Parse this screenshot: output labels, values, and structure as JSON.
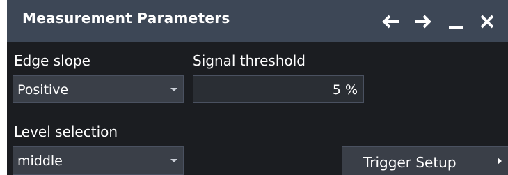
{
  "dialog": {
    "title": "Measurement Parameters",
    "buttons": {
      "back": "arrow-left-icon",
      "forward": "arrow-right-icon",
      "minimize": "minimize-icon",
      "close": "close-icon"
    }
  },
  "edge_slope": {
    "label": "Edge slope",
    "value": "Positive"
  },
  "signal_threshold": {
    "label": "Signal threshold",
    "value": "5 %"
  },
  "level_selection": {
    "label": "Level selection",
    "value": "middle"
  },
  "trigger_setup": {
    "label": "Trigger Setup"
  },
  "colors": {
    "titlebar": "#3d4756",
    "background": "#1b1d21",
    "field": "#3a3f48",
    "text": "#ffffff"
  }
}
